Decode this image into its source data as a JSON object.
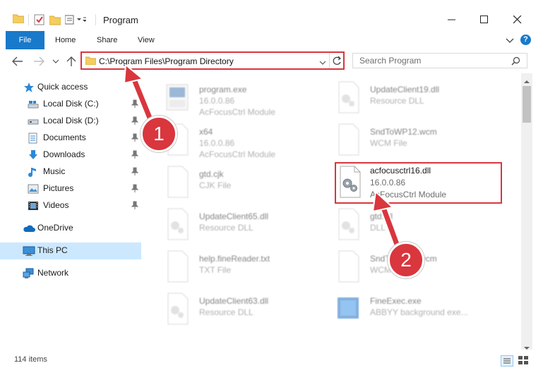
{
  "window": {
    "title": "Program",
    "controls": {
      "minimize": "—",
      "maximize": "☐",
      "close": "✕"
    }
  },
  "ribbon": {
    "tabs": [
      {
        "label": "File"
      },
      {
        "label": "Home"
      },
      {
        "label": "Share"
      },
      {
        "label": "View"
      }
    ],
    "help": "?"
  },
  "address": {
    "path": "C:\\Program Files\\Program Directory",
    "search_placeholder": "Search Program"
  },
  "nav": {
    "quick_access": "Quick access",
    "pinned": [
      {
        "label": "Local Disk (C:)",
        "icon": "drive-icon"
      },
      {
        "label": "Local Disk (D:)",
        "icon": "drive-icon"
      },
      {
        "label": "Documents",
        "icon": "documents-icon"
      },
      {
        "label": "Downloads",
        "icon": "download-icon"
      },
      {
        "label": "Music",
        "icon": "music-icon"
      },
      {
        "label": "Pictures",
        "icon": "pictures-icon"
      },
      {
        "label": "Videos",
        "icon": "videos-icon"
      }
    ],
    "onedrive": "OneDrive",
    "this_pc": "This PC",
    "network": "Network"
  },
  "files": [
    {
      "name": "program.exe",
      "line1": "16.0.0.86",
      "line2": "AcFocusCtrl Module",
      "icon": "exe-icon"
    },
    {
      "name": "UpdateClient19.dll",
      "line1": "Resource DLL",
      "line2": "",
      "icon": "dll-icon"
    },
    {
      "name": "x64",
      "line1": "16.0.0.86",
      "line2": "AcFocusCtrl Module",
      "icon": "file-icon"
    },
    {
      "name": "SndToWP12.wcm",
      "line1": "WCM File",
      "line2": "",
      "icon": "file-icon"
    },
    {
      "name": "gtd.cjk",
      "line1": "CJK File",
      "line2": "",
      "icon": "file-icon"
    },
    {
      "name": "acfocusctrl16.dll",
      "line1": "16.0.0.86",
      "line2": "AcFocusCtrl Module",
      "icon": "dll-icon"
    },
    {
      "name": "UpdateClient65.dll",
      "line1": "Resource DLL",
      "line2": "",
      "icon": "dll-icon"
    },
    {
      "name": "gtd.dll",
      "line1": "DLL",
      "line2": "",
      "icon": "dll-icon"
    },
    {
      "name": "help.fineReader.txt",
      "line1": "TXT File",
      "line2": "",
      "icon": "file-icon"
    },
    {
      "name": "SndToWP12.wcm",
      "line1": "WCM File",
      "line2": "",
      "icon": "file-icon"
    },
    {
      "name": "UpdateClient63.dll",
      "line1": "Resource DLL",
      "line2": "",
      "icon": "dll-icon"
    },
    {
      "name": "FineExec.exe",
      "line1": "ABBYY background exe...",
      "line2": "",
      "icon": "exe-icon"
    }
  ],
  "status": {
    "item_count": "114 items"
  },
  "annotations": {
    "step1": "1",
    "step2": "2",
    "accent": "#d9363e"
  }
}
